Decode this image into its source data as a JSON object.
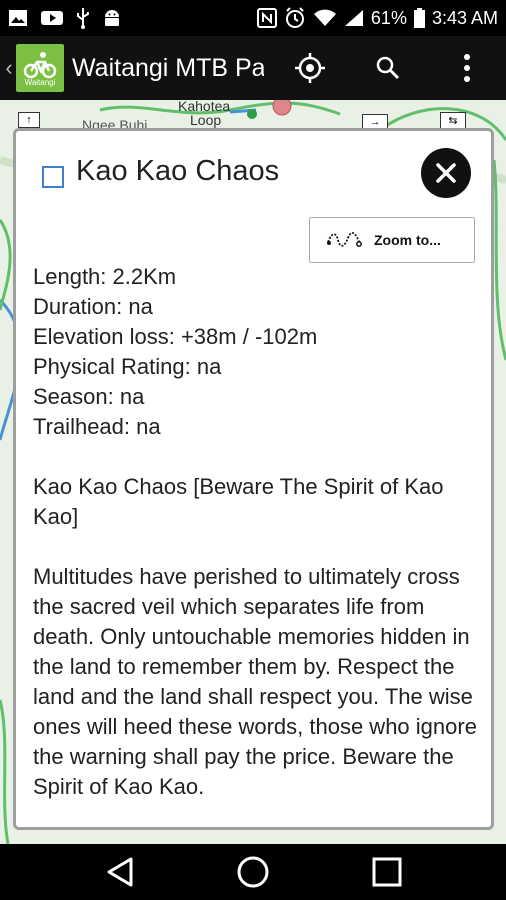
{
  "status_bar": {
    "battery": "61%",
    "time": "3:43 AM"
  },
  "app_bar": {
    "title": "Waitangi MTB Pa",
    "logo_text": "Waitangi"
  },
  "map": {
    "labels": [
      "Kahotea",
      "Loop",
      "Ngee Buhi"
    ]
  },
  "dialog": {
    "title": "Kao Kao Chaos",
    "zoom_button_label": "Zoom to...",
    "details": [
      "Length: 2.2Km",
      "Duration: na",
      "Elevation loss: +38m / -102m",
      "Physical Rating: na",
      "Season: na",
      "Trailhead: na"
    ],
    "subtitle": "Kao Kao Chaos [Beware The Spirit of Kao Kao]",
    "description": "Multitudes have perished to ultimately cross the sacred veil which separates life from death. Only untouchable memories hidden in the land to remember them by. Respect the land and the land shall respect you. The wise ones will heed these words, those who ignore the warning shall pay the price. Beware the Spirit of Kao Kao."
  },
  "colors": {
    "accent_checkbox": "#3f7fcb",
    "logo_green": "#7bc043",
    "map_bg": "#e9f1e6",
    "trail_green": "#5fbf6a",
    "trail_blue": "#4a90d9"
  }
}
